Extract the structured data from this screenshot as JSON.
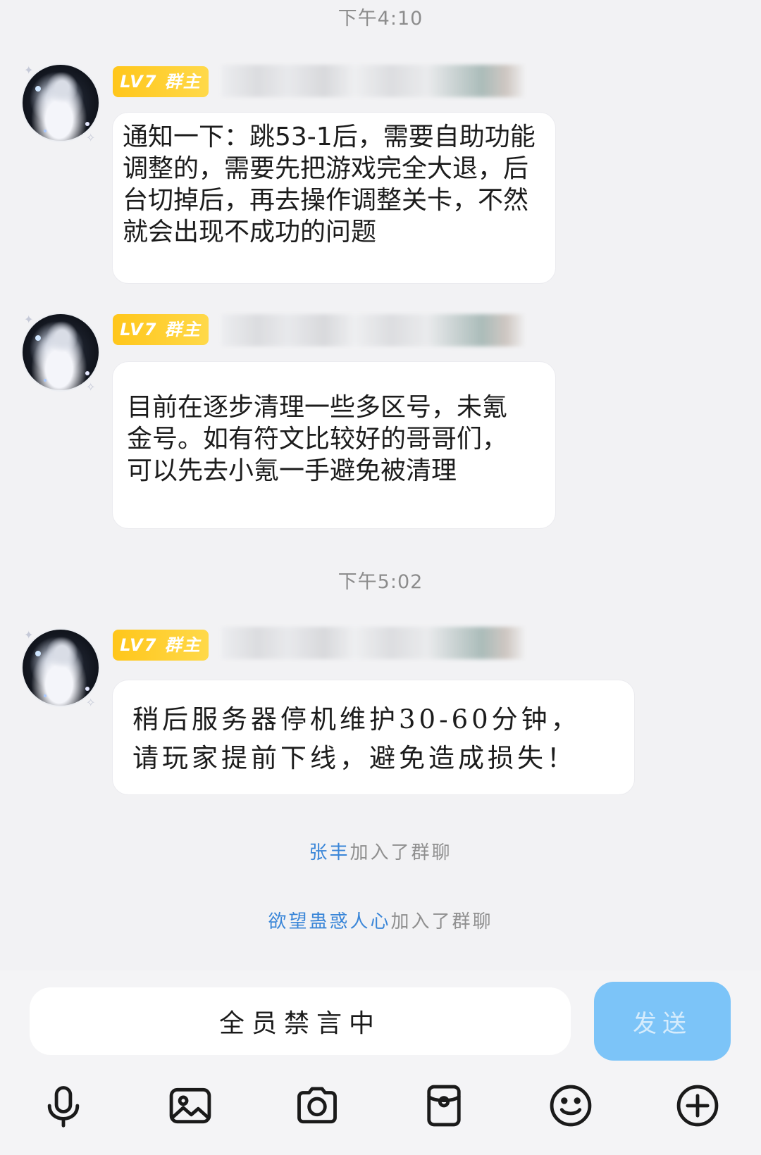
{
  "messages": [
    {
      "time": "下午4:10",
      "badge": "LV7 群主",
      "text": "通知一下：跳53-1后，需要自助功能调整的，需要先把游戏完全大退，后台切掉后，再去操作调整关卡，不然就会出现不成功的问题"
    },
    {
      "badge": "LV7 群主",
      "text": "目前在逐步清理一些多区号，未氪金号。如有符文比较好的哥哥们，可以先去小氪一手避免被清理"
    },
    {
      "time": "下午5:02",
      "badge": "LV7 群主",
      "text_lines": [
        "稍后服务器停机维护30-60分钟，",
        "请玩家提前下线，避免造成损失！"
      ]
    }
  ],
  "system_events": [
    {
      "user": "张丰",
      "action": "加入了群聊"
    },
    {
      "user": "欲望蛊惑人心",
      "action": "加入了群聊"
    }
  ],
  "composer": {
    "muted_text": "全员禁言中",
    "send_label": "发送"
  },
  "toolbar_icons": [
    "microphone-icon",
    "image-icon",
    "camera-icon",
    "red-packet-icon",
    "emoji-icon",
    "plus-icon"
  ],
  "colors": {
    "badge": "#ffc61a",
    "send_button": "#7cc4f8",
    "username_link": "#3a86d8",
    "background": "#f2f2f4"
  }
}
